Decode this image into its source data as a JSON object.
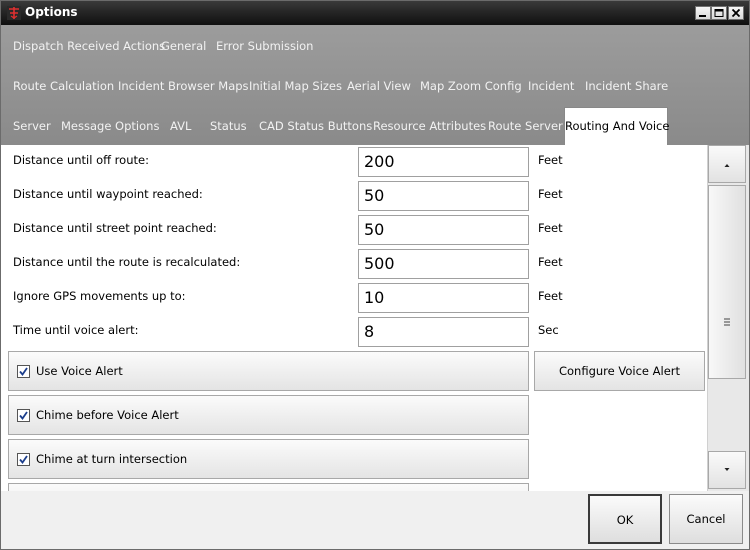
{
  "window": {
    "title": "Options"
  },
  "tabs": {
    "row1": [
      "Dispatch Received Actions",
      "General",
      "Error Submission"
    ],
    "row2": [
      "Route Calculation",
      "Incident Browser Maps",
      "Initial Map Sizes",
      "Aerial View",
      "Map Zoom Config",
      "Incident",
      "Incident Share"
    ],
    "row3": [
      "Server",
      "Message Options",
      "AVL",
      "Status",
      "CAD Status Buttons",
      "Resource Attributes",
      "Route Server",
      "Routing And Voice"
    ],
    "active": "Routing And Voice"
  },
  "settings": [
    {
      "label": "Distance until off route:",
      "value": "200",
      "unit": "Feet"
    },
    {
      "label": "Distance until waypoint reached:",
      "value": "50",
      "unit": "Feet"
    },
    {
      "label": "Distance until street point reached:",
      "value": "50",
      "unit": "Feet"
    },
    {
      "label": "Distance until the route is recalculated:",
      "value": "500",
      "unit": "Feet"
    },
    {
      "label": "Ignore GPS movements up to:",
      "value": "10",
      "unit": "Feet"
    },
    {
      "label": "Time until voice alert:",
      "value": "8",
      "unit": "Sec"
    }
  ],
  "checkboxes": [
    {
      "label": "Use Voice Alert",
      "checked": true
    },
    {
      "label": "Chime before Voice Alert",
      "checked": true
    },
    {
      "label": "Chime at turn intersection",
      "checked": true
    }
  ],
  "configure_button": "Configure Voice Alert",
  "footer": {
    "ok_label": "OK",
    "cancel_label": "Cancel"
  }
}
